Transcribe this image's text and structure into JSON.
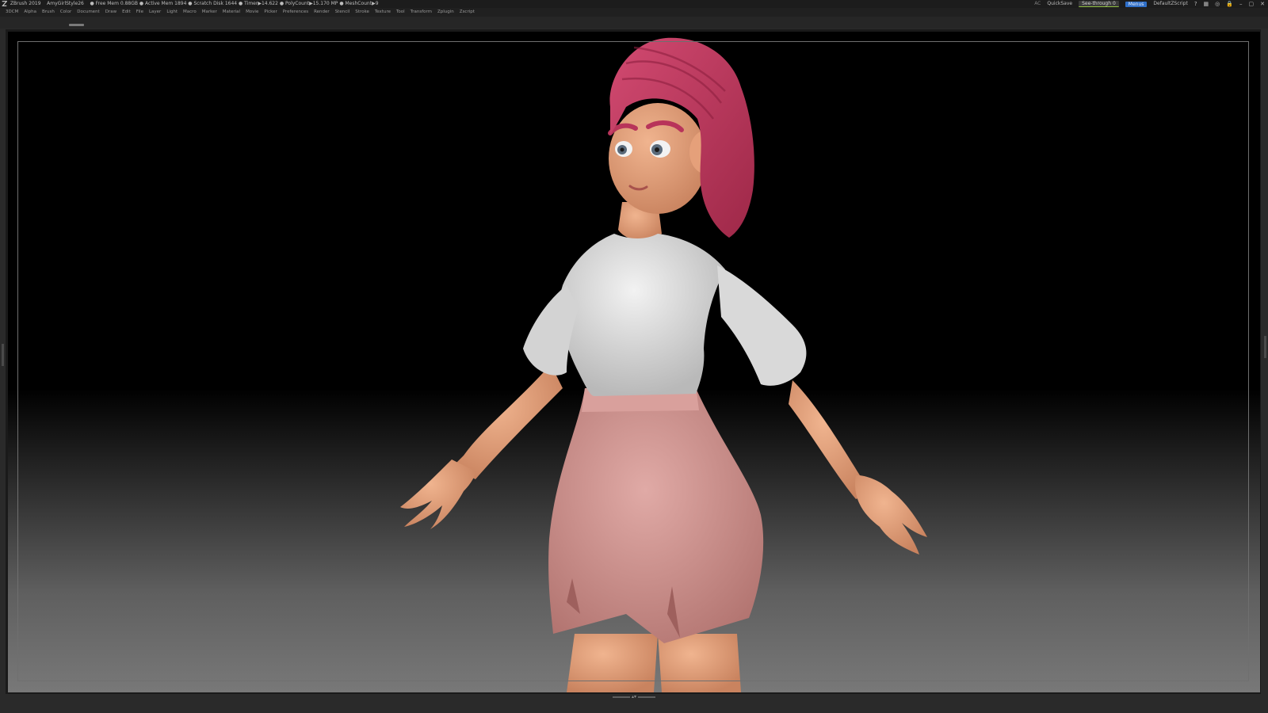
{
  "titlebar": {
    "app": "ZBrush 2019",
    "document": "AmyGirlStyle26",
    "stats": "● Free Mem 0.88GB ● Active Mem 1894 ● Scratch Disk 1644 ● Timer▶14.622 ● PolyCount▶15.170 MP ● MeshCount▶9",
    "ac_label": "AC",
    "quicksave_label": "QuickSave",
    "seethrough_label": "See-through",
    "seethrough_value": "0",
    "menus_label": "Menus",
    "script_label": "DefaultZScript",
    "icons": [
      "help-icon",
      "layout-icon",
      "brush-palette-icon",
      "lock-icon",
      "minimize-icon",
      "maximize-icon",
      "close-icon"
    ],
    "icon_glyphs": [
      "?",
      "▦",
      "◎",
      "🔒",
      "–",
      "▢",
      "✕"
    ]
  },
  "menubar": {
    "items": [
      "3DCM",
      "Alpha",
      "Brush",
      "Color",
      "Document",
      "Draw",
      "Edit",
      "File",
      "Layer",
      "Light",
      "Macro",
      "Marker",
      "Material",
      "Movie",
      "Picker",
      "Preferences",
      "Render",
      "Stencil",
      "Stroke",
      "Texture",
      "Tool",
      "Transform",
      "Zplugin",
      "Zscript"
    ]
  },
  "colors": {
    "hair": "#c0395f",
    "skin": "#e8a57e",
    "shirt": "#e6e6e6",
    "skirt": "#d99c98",
    "accent_blue": "#2f6fc8",
    "accent_green": "#8fbf3f"
  }
}
